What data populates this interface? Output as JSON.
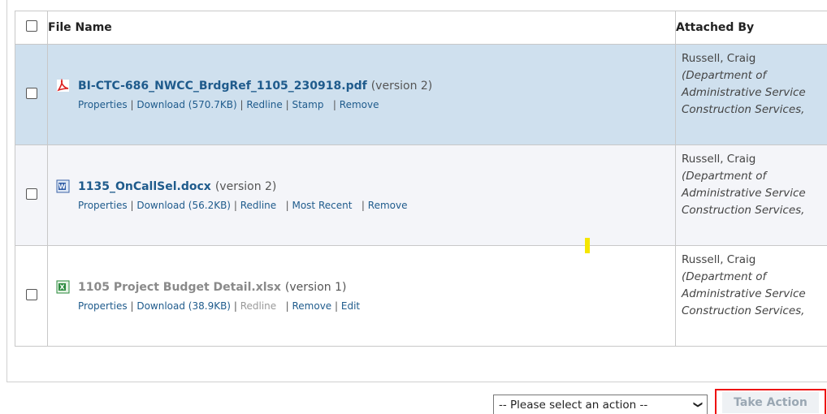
{
  "table": {
    "headers": {
      "file_name": "File Name",
      "attached_by": "Attached By"
    },
    "rows": [
      {
        "file_name": "BI-CTC-686_NWCC_BrdgRef_1105_230918.pdf",
        "version": "(version 2)",
        "icon": "pdf-icon",
        "actions": [
          "Properties",
          "Download (570.7KB)",
          "Redline",
          "Stamp",
          "Remove"
        ],
        "attached_by": {
          "name": "Russell, Craig",
          "org1": "(Department of",
          "org2": "Administrative Service",
          "org3": "Construction Services,"
        }
      },
      {
        "file_name": "1135_OnCallSel.docx",
        "version": "(version 2)",
        "icon": "word-icon",
        "actions": [
          "Properties",
          "Download (56.2KB)",
          "Redline",
          "Most Recent",
          "Remove"
        ],
        "attached_by": {
          "name": "Russell, Craig",
          "org1": "(Department of",
          "org2": "Administrative Service",
          "org3": "Construction Services,"
        }
      },
      {
        "file_name": "1105 Project Budget Detail.xlsx",
        "version": "(version 1)",
        "icon": "excel-icon",
        "actions": [
          "Properties",
          "Download (38.9KB)",
          "Redline",
          "Remove",
          "Edit"
        ],
        "attached_by": {
          "name": "Russell, Craig",
          "org1": "(Department of",
          "org2": "Administrative Service",
          "org3": "Construction Services,"
        }
      }
    ]
  },
  "footer": {
    "select_value": "-- Please select an action --",
    "take_action_label": "Take Action"
  },
  "colors": {
    "selected_row": "#cfe0ee",
    "link": "#1f5b8c",
    "highlight_border": "#e11111"
  }
}
